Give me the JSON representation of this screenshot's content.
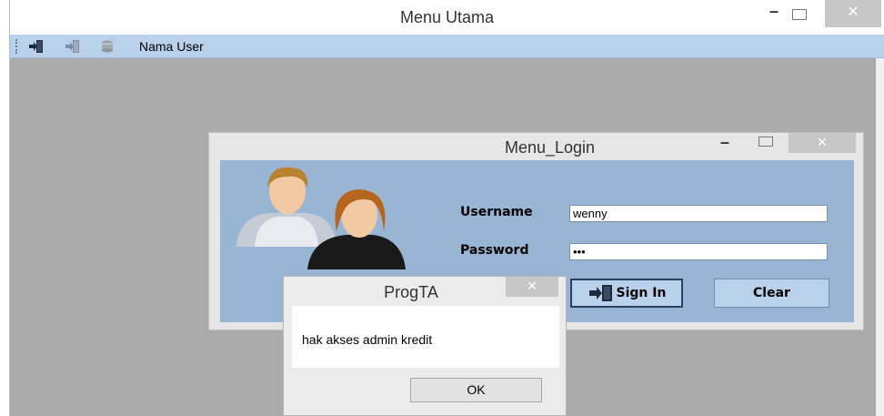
{
  "main_window": {
    "title": "Menu Utama",
    "minimize": "–",
    "close": "✕",
    "toolbar": {
      "user_label": "Nama User"
    }
  },
  "login_window": {
    "title": "Menu_Login",
    "minimize": "–",
    "close": "✕",
    "username_label": "Username",
    "username_value": "wenny",
    "password_label": "Password",
    "password_value": "•••",
    "signin_label": "Sign In",
    "clear_label": "Clear"
  },
  "message_box": {
    "title": "ProgTA",
    "close": "✕",
    "message": "hak akses admin kredit",
    "ok_label": "OK"
  },
  "colors": {
    "toolbar": "#bad1ec",
    "workspace": "#ababab",
    "login_body": "#98b5d4"
  }
}
